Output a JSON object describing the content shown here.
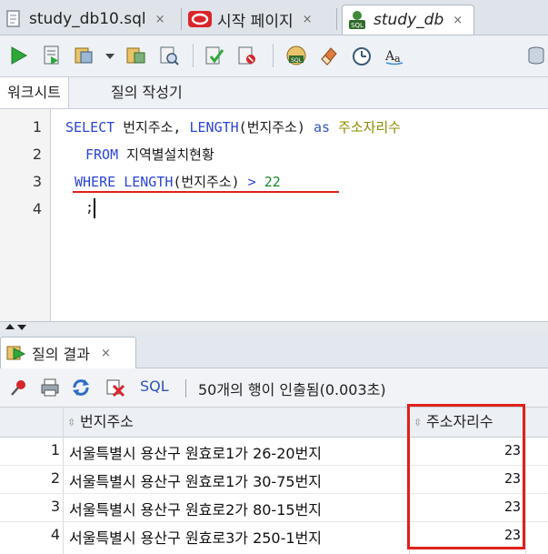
{
  "doc_tabs": [
    {
      "label": "study_db10.sql",
      "close": "×"
    },
    {
      "label": "시작 페이지",
      "close": "×"
    },
    {
      "label": "study_db",
      "close": "×"
    }
  ],
  "sub_tabs": {
    "worksheet": "워크시트",
    "query_builder": "질의 작성기"
  },
  "editor": {
    "line_numbers": [
      "1",
      "2",
      "3",
      "4"
    ],
    "line1": {
      "kw1": "SELECT",
      "a": " 번지주소, ",
      "kw2": "LENGTH",
      "b": "(번지주소) ",
      "kw3": "as",
      "c": " ",
      "alias": "주소자리수"
    },
    "line2": {
      "kw1": "FROM",
      "a": " 지역별설치현황"
    },
    "line3": {
      "kw1": "WHERE",
      "a": " ",
      "kw2": "LENGTH",
      "b": "(번지주소) ",
      "op": ">",
      "c": " ",
      "num": "22"
    },
    "line4": {
      "a": ";"
    }
  },
  "result_tab": {
    "label": "질의 결과",
    "close": "×"
  },
  "result_toolbar": {
    "sql_label": "SQL",
    "status": "50개의 행이 인출됨(0.003초)"
  },
  "grid": {
    "columns": [
      "번지주소",
      "주소자리수"
    ],
    "rows": [
      {
        "num": "1",
        "addr": "서울특별시 용산구 원효로1가 26-20번지",
        "len": "23"
      },
      {
        "num": "2",
        "addr": "서울특별시 용산구 원효로1가 30-75번지",
        "len": "23"
      },
      {
        "num": "3",
        "addr": "서울특별시 용산구 원효로2가 80-15번지",
        "len": "23"
      },
      {
        "num": "4",
        "addr": "서울특별시 용산구 원효로3가 250-1번지",
        "len": "23"
      }
    ]
  },
  "colors": {
    "keyword": "#2b44d8",
    "highlight_red": "#e0201c",
    "number": "#1a8a2a",
    "alias": "#8b8b00"
  }
}
